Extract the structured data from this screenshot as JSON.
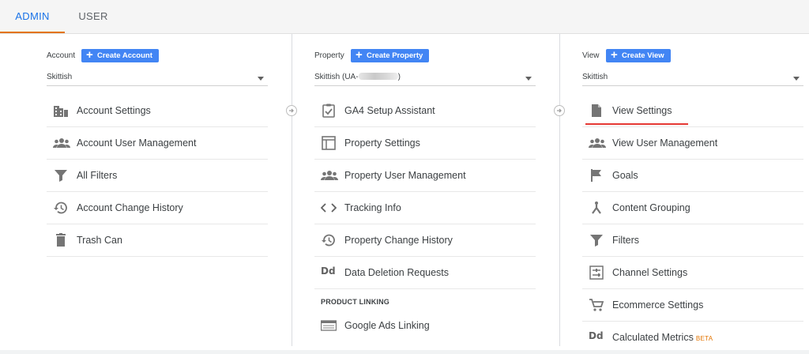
{
  "tabs": [
    {
      "label": "ADMIN"
    },
    {
      "label": "USER"
    }
  ],
  "colors": {
    "accent": "#1a73e8",
    "tab_underline": "#e37400",
    "button": "#4285f4",
    "highlight_line": "#e53935",
    "beta": "#e37400"
  },
  "account": {
    "label": "Account",
    "create_label": "Create Account",
    "selected": "Skittish",
    "items": [
      {
        "label": "Account Settings",
        "icon": "building-icon"
      },
      {
        "label": "Account User Management",
        "icon": "people-icon"
      },
      {
        "label": "All Filters",
        "icon": "filter-icon"
      },
      {
        "label": "Account Change History",
        "icon": "history-icon"
      },
      {
        "label": "Trash Can",
        "icon": "trash-icon"
      }
    ]
  },
  "property": {
    "label": "Property",
    "create_label": "Create Property",
    "selected_prefix": "Skittish (UA-",
    "selected_suffix": ")",
    "items": [
      {
        "label": "GA4 Setup Assistant",
        "icon": "clipboard-check-icon"
      },
      {
        "label": "Property Settings",
        "icon": "web-icon"
      },
      {
        "label": "Property User Management",
        "icon": "people-icon"
      },
      {
        "label": "Tracking Info",
        "icon": "code-icon"
      },
      {
        "label": "Property Change History",
        "icon": "history-icon"
      },
      {
        "label": "Data Deletion Requests",
        "icon": "data-deletion-icon",
        "icon_text": "Dd"
      }
    ],
    "section_title": "PRODUCT LINKING",
    "linking_items": [
      {
        "label": "Google Ads Linking",
        "icon": "ads-linking-icon"
      }
    ]
  },
  "view": {
    "label": "View",
    "create_label": "Create View",
    "selected": "Skittish",
    "items": [
      {
        "label": "View Settings",
        "icon": "document-icon"
      },
      {
        "label": "View User Management",
        "icon": "people-icon"
      },
      {
        "label": "Goals",
        "icon": "flag-icon"
      },
      {
        "label": "Content Grouping",
        "icon": "grouping-icon"
      },
      {
        "label": "Filters",
        "icon": "filter-icon"
      },
      {
        "label": "Channel Settings",
        "icon": "channel-settings-icon"
      },
      {
        "label": "Ecommerce Settings",
        "icon": "cart-icon"
      },
      {
        "label": "Calculated Metrics",
        "icon": "calculated-metrics-icon",
        "icon_text": "Dd",
        "badge": "BETA"
      }
    ]
  }
}
